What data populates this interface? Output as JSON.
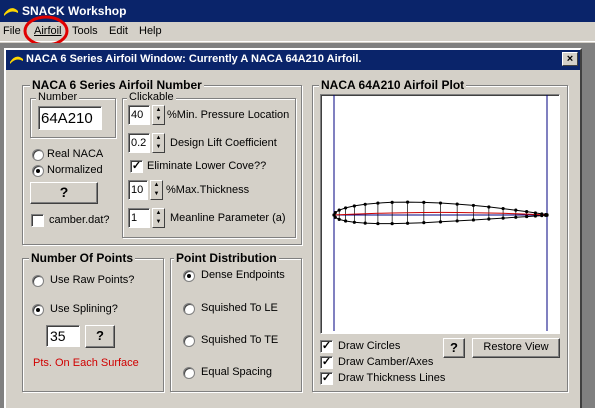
{
  "app": {
    "title": "SNACK Workshop"
  },
  "menu": {
    "items": [
      "File",
      "Airfoil",
      "Tools",
      "Edit",
      "Help"
    ]
  },
  "window": {
    "title": "NACA 6 Series Airfoil Window: Currently A NACA 64A210 Airfoil.",
    "close_label": "×"
  },
  "number_group": {
    "title": "NACA 6 Series Airfoil Number",
    "number_label": "Number",
    "number_value": "64A210",
    "real_naca_label": "Real NACA",
    "normalized_label": "Normalized",
    "normalized_selected": true,
    "question_label": "?",
    "camber_label": "camber.dat?",
    "clickable_label": "Clickable",
    "min_pressure_value": "40",
    "min_pressure_label": "%Min. Pressure Location",
    "design_lift_value": "0.2",
    "design_lift_label": "Design Lift Coefficient",
    "eliminate_cove_label": "Eliminate Lower Cove??",
    "eliminate_cove_checked": true,
    "max_thickness_value": "10",
    "max_thickness_label": "%Max.Thickness",
    "meanline_value": "1",
    "meanline_label": "Meanline Parameter (a)"
  },
  "points_group": {
    "title": "Number Of Points",
    "raw_label": "Use Raw Points?",
    "splining_label": "Use Splining?",
    "splining_selected": true,
    "count_value": "35",
    "question_label": "?",
    "note": "Pts. On Each Surface"
  },
  "distribution_group": {
    "title": "Point Distribution",
    "options": [
      "Dense Endpoints",
      "Squished To LE",
      "Squished To TE",
      "Equal Spacing"
    ],
    "selected_index": 0
  },
  "plot_group": {
    "title": "NACA 64A210 Airfoil Plot",
    "draw_circles_label": "Draw Circles",
    "draw_camber_label": "Draw Camber/Axes",
    "draw_thickness_label": "Draw Thickness Lines",
    "question_label": "?",
    "restore_label": "Restore View",
    "all_checked": true
  },
  "colors": {
    "title_bar": "#0a246a",
    "face": "#d4d0c8",
    "note_red": "#d00000",
    "camber_line": "#cc0000",
    "axes": "#000080"
  }
}
